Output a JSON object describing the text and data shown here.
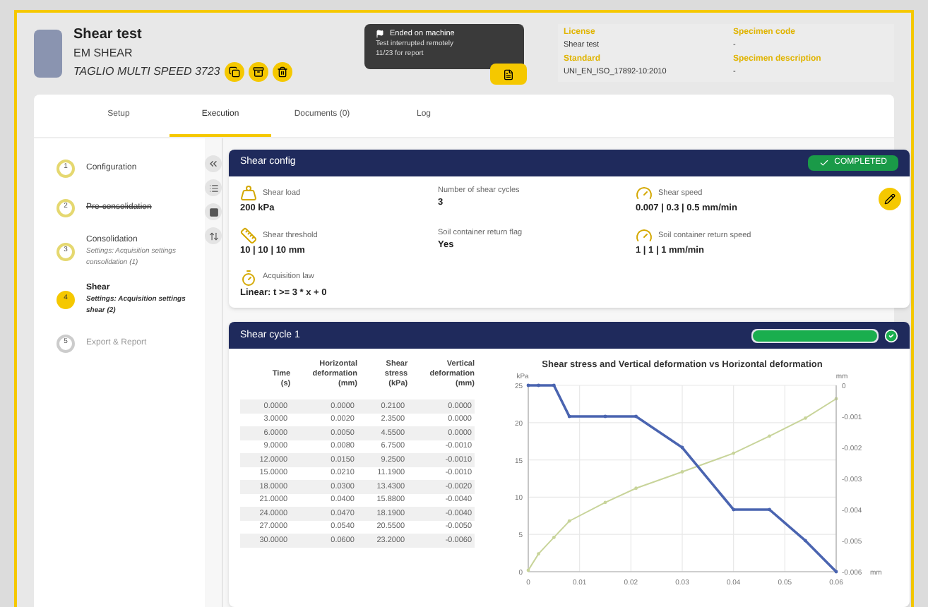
{
  "test": {
    "title": "Shear test",
    "machine": "EM SHEAR",
    "program": "TAGLIO MULTI SPEED 3723"
  },
  "status_box": {
    "title": "Ended on machine",
    "lines": [
      "Test interrupted remotely",
      "11/23 for report"
    ]
  },
  "info": [
    {
      "label": "License",
      "value": "Shear test"
    },
    {
      "label": "Specimen code",
      "value": "-"
    },
    {
      "label": "Standard",
      "value": "UNI_EN_ISO_17892-10:2010"
    },
    {
      "label": "Specimen description",
      "value": "-"
    }
  ],
  "tabs": [
    {
      "label": "Setup",
      "selected": false
    },
    {
      "label": "Execution",
      "selected": true
    },
    {
      "label": "Documents (0)",
      "selected": false
    },
    {
      "label": "Log",
      "selected": false
    }
  ],
  "steps": [
    {
      "number": "1",
      "title": "Configuration",
      "completed": true,
      "skipped": false,
      "selected": false
    },
    {
      "number": "2",
      "title": "Pre-consolidation",
      "completed": true,
      "skipped": true,
      "selected": false
    },
    {
      "number": "3",
      "title": "Consolidation",
      "subtitle": "Settings: Acquisition settings consolidation (1)",
      "completed": true,
      "skipped": false,
      "selected": false
    },
    {
      "number": "4",
      "title": "Shear",
      "subtitle": "Settings: Acquisition settings shear (2)",
      "completed": false,
      "skipped": false,
      "selected": true
    },
    {
      "number": "5",
      "title": "Export & Report",
      "completed": false,
      "skipped": false,
      "selected": false
    }
  ],
  "config": {
    "title": "Shear config",
    "badge": "COMPLETED",
    "fields": [
      {
        "kind": "weight",
        "label": "Shear load",
        "value": "200 kPa"
      },
      {
        "kind": "none",
        "label": "Number of shear cycles",
        "value": "3"
      },
      {
        "kind": "gauge",
        "label": "Shear speed",
        "value": "0.007 | 0.3 | 0.5 mm/min"
      },
      {
        "kind": "ruler",
        "label": "Shear threshold",
        "value": "10 | 10 | 10 mm"
      },
      {
        "kind": "none",
        "label": "Soil container return flag",
        "value": "Yes"
      },
      {
        "kind": "gauge",
        "label": "Soil container return speed",
        "value": "1 | 1 | 1 mm/min"
      },
      {
        "kind": "timer",
        "label": "Acquisition law",
        "value": "Linear: t >= 3 * x + 0"
      }
    ]
  },
  "cycle": {
    "title": "Shear cycle 1",
    "level": 1,
    "table": {
      "columns": [
        "Time (s)",
        "Horizontal deformation (mm)",
        "Shear stress (kPa)",
        "Vertical deformation (mm)"
      ],
      "rows": [
        [
          "0.0000",
          "0.0000",
          "0.2100",
          "0.0000"
        ],
        [
          "3.0000",
          "0.0020",
          "2.3500",
          "0.0000"
        ],
        [
          "6.0000",
          "0.0050",
          "4.5500",
          "0.0000"
        ],
        [
          "9.0000",
          "0.0080",
          "6.7500",
          "-0.0010"
        ],
        [
          "12.0000",
          "0.0150",
          "9.2500",
          "-0.0010"
        ],
        [
          "15.0000",
          "0.0210",
          "11.1900",
          "-0.0010"
        ],
        [
          "18.0000",
          "0.0300",
          "13.4300",
          "-0.0020"
        ],
        [
          "21.0000",
          "0.0400",
          "15.8800",
          "-0.0040"
        ],
        [
          "24.0000",
          "0.0470",
          "18.1900",
          "-0.0040"
        ],
        [
          "27.0000",
          "0.0540",
          "20.5500",
          "-0.0050"
        ],
        [
          "30.0000",
          "0.0600",
          "23.2000",
          "-0.0060"
        ]
      ]
    },
    "chart_layers": [
      {
        "chart_data": {
          "type": "line",
          "title": "Shear stress and Vertical deformation vs Horizontal deformation",
          "ylabel": "kPa",
          "grid": true,
          "x": [
            0,
            0.002,
            0.005,
            0.008,
            0.015,
            0.021,
            0.03,
            0.04,
            0.047,
            0.054,
            0.06
          ],
          "series": [
            {
              "color": "#c8d49a",
              "values": [
                0.2,
                2.4,
                4.6,
                6.8,
                9.3,
                11.2,
                13.4,
                15.9,
                18.2,
                20.6,
                23.2
              ]
            }
          ],
          "xlim": [
            0,
            0.06
          ],
          "ylim": [
            0,
            25
          ],
          "xticks": [
            {
              "value": 0,
              "label": "0"
            },
            {
              "value": 0.01,
              "label": "0.01"
            },
            {
              "value": 0.02,
              "label": "0.02"
            },
            {
              "value": 0.03,
              "label": "0.03"
            },
            {
              "value": 0.04,
              "label": "0.04"
            },
            {
              "value": 0.05,
              "label": "0.05"
            },
            {
              "value": 0.06,
              "label": "0.06"
            }
          ],
          "yticks": [
            0,
            5,
            10,
            15,
            20,
            25
          ]
        }
      },
      {
        "chart_data": {
          "type": "line",
          "ylabel": "mm",
          "xlabel": "mm",
          "x": [
            0,
            0.002,
            0.005,
            0.008,
            0.015,
            0.021,
            0.03,
            0.04,
            0.047,
            0.054,
            0.06
          ],
          "series": [
            {
              "color": "#4a64b0",
              "values": [
                0,
                0,
                0,
                -0.001,
                -0.001,
                -0.001,
                -0.002,
                -0.004,
                -0.004,
                -0.005,
                -0.006
              ]
            }
          ],
          "xlim": [
            0,
            0.06
          ],
          "ylim": [
            -0.006,
            0
          ],
          "yticks": [
            {
              "value": 0,
              "label": "0"
            },
            {
              "value": -0.001,
              "label": "-0.001"
            },
            {
              "value": -0.002,
              "label": "-0.002"
            },
            {
              "value": -0.003,
              "label": "-0.003"
            },
            {
              "value": -0.004,
              "label": "-0.004"
            },
            {
              "value": -0.005,
              "label": "-0.005"
            },
            {
              "value": -0.006,
              "label": "-0.006"
            }
          ]
        }
      }
    ]
  }
}
